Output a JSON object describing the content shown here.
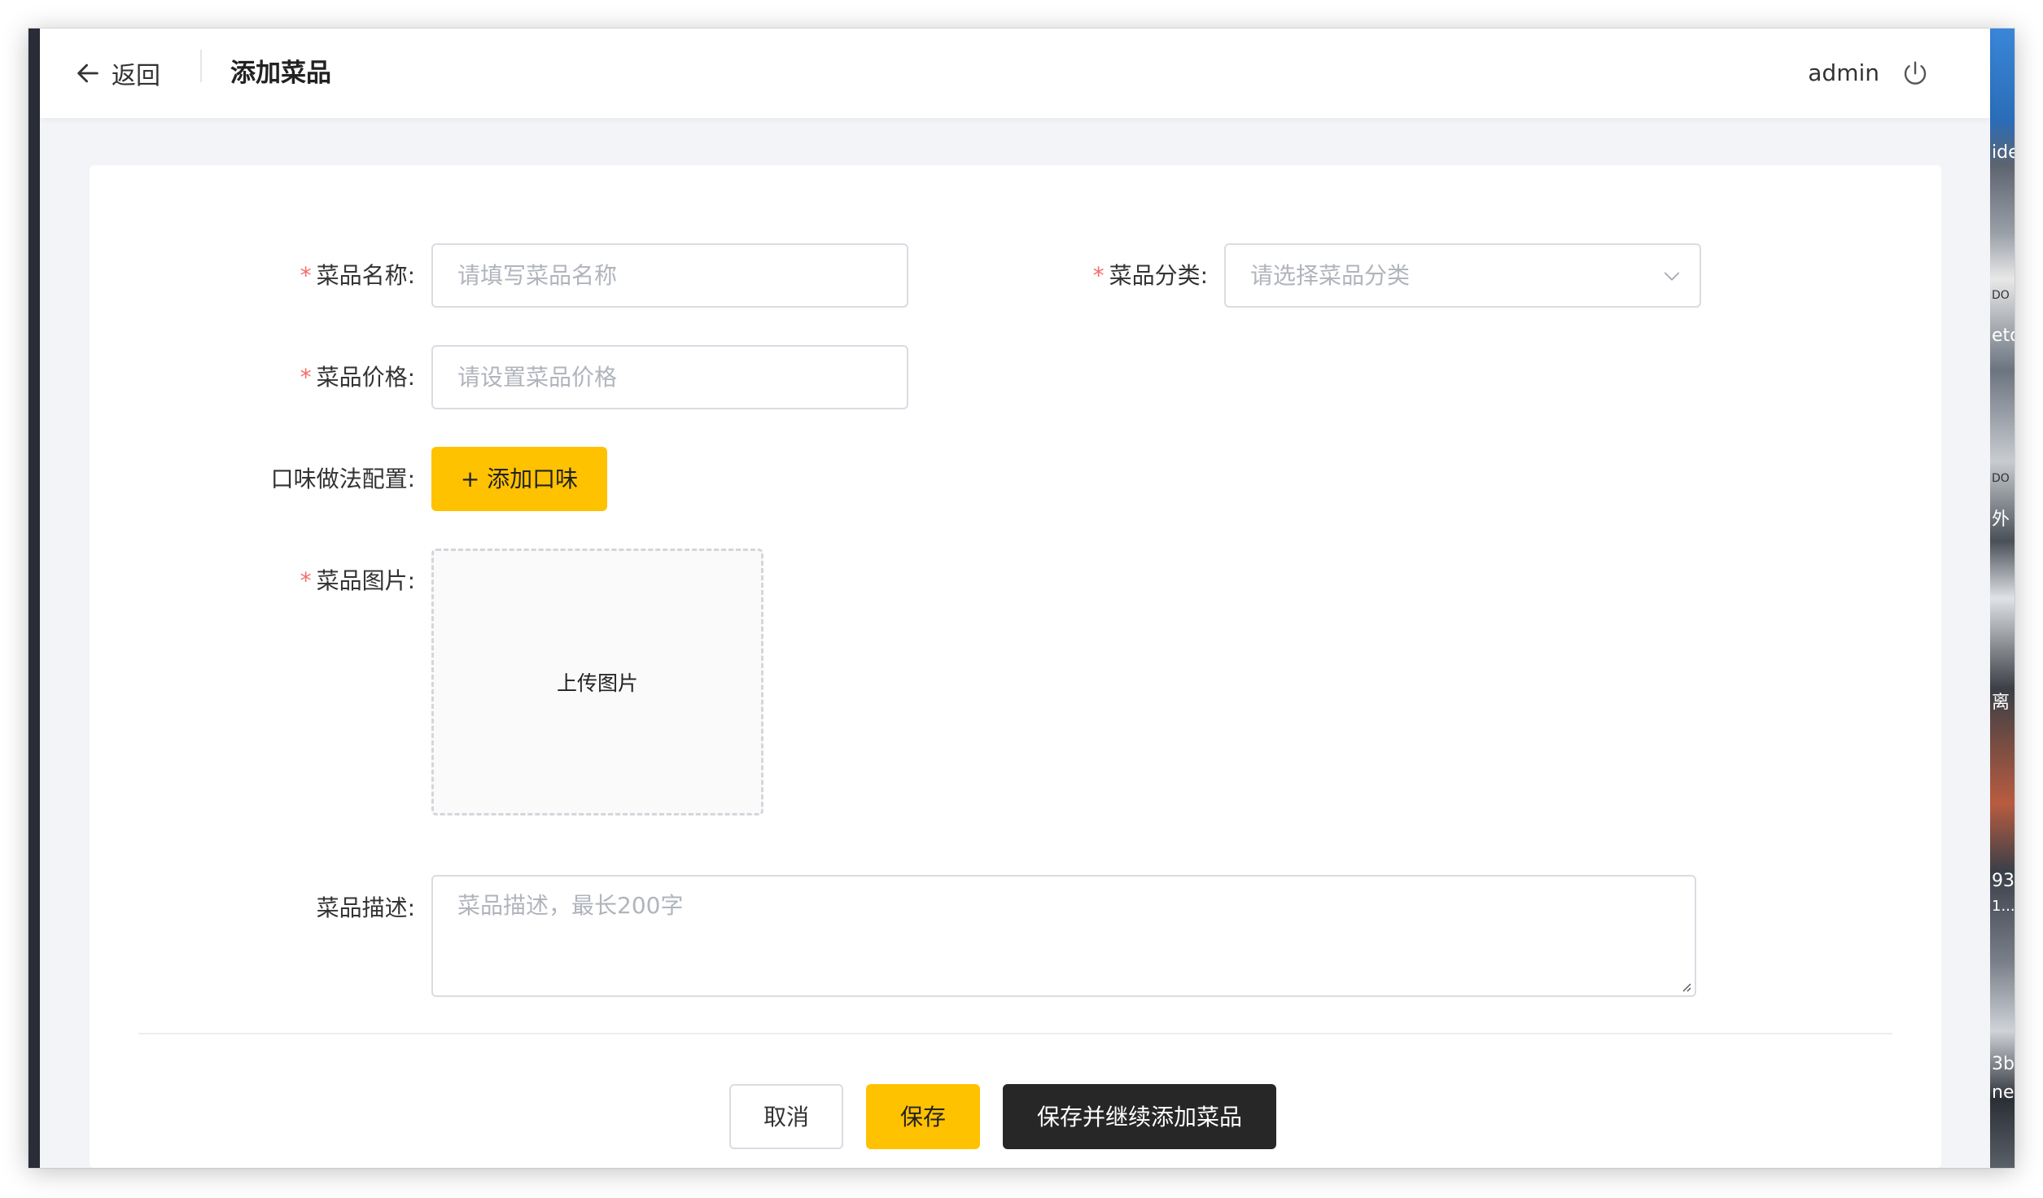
{
  "header": {
    "back_label": "返回",
    "title": "添加菜品",
    "user": "admin"
  },
  "form": {
    "name": {
      "label": "菜品名称:",
      "placeholder": "请填写菜品名称",
      "required": true
    },
    "category": {
      "label": "菜品分类:",
      "placeholder": "请选择菜品分类",
      "required": true
    },
    "price": {
      "label": "菜品价格:",
      "placeholder": "请设置菜品价格",
      "required": true
    },
    "flavor": {
      "label": "口味做法配置:",
      "button_label": "+ 添加口味"
    },
    "image": {
      "label": "菜品图片:",
      "upload_label": "上传图片",
      "required": true
    },
    "description": {
      "label": "菜品描述:",
      "placeholder": "菜品描述，最长200字"
    }
  },
  "actions": {
    "cancel": "取消",
    "save": "保存",
    "save_continue": "保存并继续添加菜品"
  },
  "background_fragments": [
    "ide",
    "DO",
    "eto",
    "DO",
    "外",
    "离",
    "93",
    "1...",
    "3b",
    "ne"
  ],
  "colors": {
    "accent": "#ffc200",
    "required_star": "#f56c6c",
    "dark_button": "#272727"
  }
}
